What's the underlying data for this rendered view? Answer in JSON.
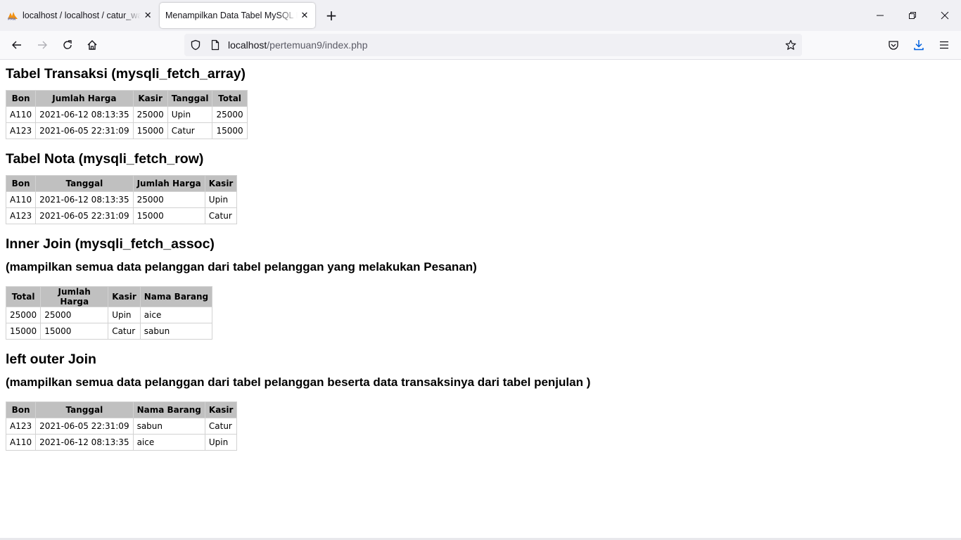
{
  "browser": {
    "tabs": [
      {
        "title": "localhost / localhost / catur_wa",
        "close_glyph": "✕"
      },
      {
        "title": "Menampilkan Data Tabel MySQL De",
        "close_glyph": "✕"
      }
    ],
    "new_tab_glyph": "+",
    "url_host": "localhost",
    "url_path": "/pertemuan9/index.php"
  },
  "sections": {
    "transaksi": {
      "title": "Tabel Transaksi (mysqli_fetch_array)",
      "headers": [
        "Bon",
        "Jumlah Harga",
        "Kasir",
        "Tanggal",
        "Total"
      ],
      "rows": [
        [
          "A110",
          "2021-06-12 08:13:35",
          "25000",
          "Upin",
          "25000"
        ],
        [
          "A123",
          "2021-06-05 22:31:09",
          "15000",
          "Catur",
          "15000"
        ]
      ]
    },
    "nota": {
      "title": "Tabel Nota (mysqli_fetch_row)",
      "headers": [
        "Bon",
        "Tanggal",
        "Jumlah Harga",
        "Kasir"
      ],
      "rows": [
        [
          "A110",
          "2021-06-12 08:13:35",
          "25000",
          "Upin"
        ],
        [
          "A123",
          "2021-06-05 22:31:09",
          "15000",
          "Catur"
        ]
      ]
    },
    "inner_join": {
      "title": "Inner Join (mysqli_fetch_assoc)",
      "subtitle": "(mampilkan semua data pelanggan dari tabel pelanggan yang melakukan Pesanan)",
      "headers": [
        "Total",
        "Jumlah Harga",
        "Kasir",
        "Nama Barang"
      ],
      "rows": [
        [
          "25000",
          "25000",
          "Upin",
          "aice"
        ],
        [
          "15000",
          "15000",
          "Catur",
          "sabun"
        ]
      ]
    },
    "left_join": {
      "title": "left outer Join",
      "subtitle": "(mampilkan semua data pelanggan dari tabel pelanggan beserta data transaksinya dari tabel penjulan )",
      "headers": [
        "Bon",
        "Tanggal",
        "Nama Barang",
        "Kasir"
      ],
      "rows": [
        [
          "A123",
          "2021-06-05 22:31:09",
          "sabun",
          "Catur"
        ],
        [
          "A110",
          "2021-06-12 08:13:35",
          "aice",
          "Upin"
        ]
      ]
    }
  }
}
